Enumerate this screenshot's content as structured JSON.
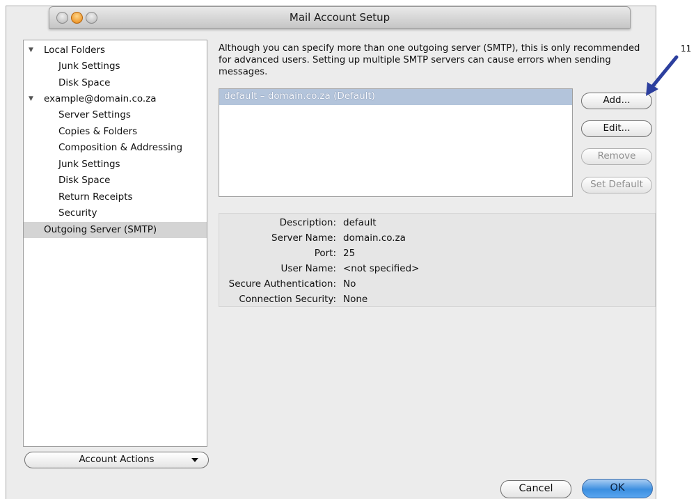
{
  "window": {
    "title": "Mail Account Setup"
  },
  "sidebar": {
    "items": [
      {
        "label": "Local Folders",
        "expanded": true
      },
      {
        "label": "Junk Settings"
      },
      {
        "label": "Disk Space"
      },
      {
        "label": "example@domain.co.za",
        "expanded": true
      },
      {
        "label": "Server Settings"
      },
      {
        "label": "Copies & Folders"
      },
      {
        "label": "Composition & Addressing"
      },
      {
        "label": "Junk Settings"
      },
      {
        "label": "Disk Space"
      },
      {
        "label": "Return Receipts"
      },
      {
        "label": "Security"
      },
      {
        "label": "Outgoing Server (SMTP)",
        "selected": true
      }
    ],
    "account_actions": "Account Actions"
  },
  "smtp": {
    "description": "Although you can specify more than one outgoing server (SMTP), this is only recommended for advanced users. Setting up multiple SMTP servers can cause errors when sending messages.",
    "servers": [
      "default – domain.co.za (Default)"
    ],
    "buttons": {
      "add": "Add...",
      "edit": "Edit...",
      "remove": "Remove",
      "set_default": "Set Default"
    },
    "details": [
      {
        "label": "Description:",
        "value": "default"
      },
      {
        "label": "Server Name:",
        "value": "domain.co.za"
      },
      {
        "label": "Port:",
        "value": "25"
      },
      {
        "label": "User Name:",
        "value": "<not specified>"
      },
      {
        "label": "Secure Authentication:",
        "value": "No"
      },
      {
        "label": "Connection Security:",
        "value": "None"
      }
    ]
  },
  "footer": {
    "cancel": "Cancel",
    "ok": "OK"
  },
  "annotation": {
    "number": "11"
  },
  "colors": {
    "selection": "#b3c4db",
    "ok_button": "#3c8fe0",
    "callout_arrow": "#2c3f9e"
  }
}
